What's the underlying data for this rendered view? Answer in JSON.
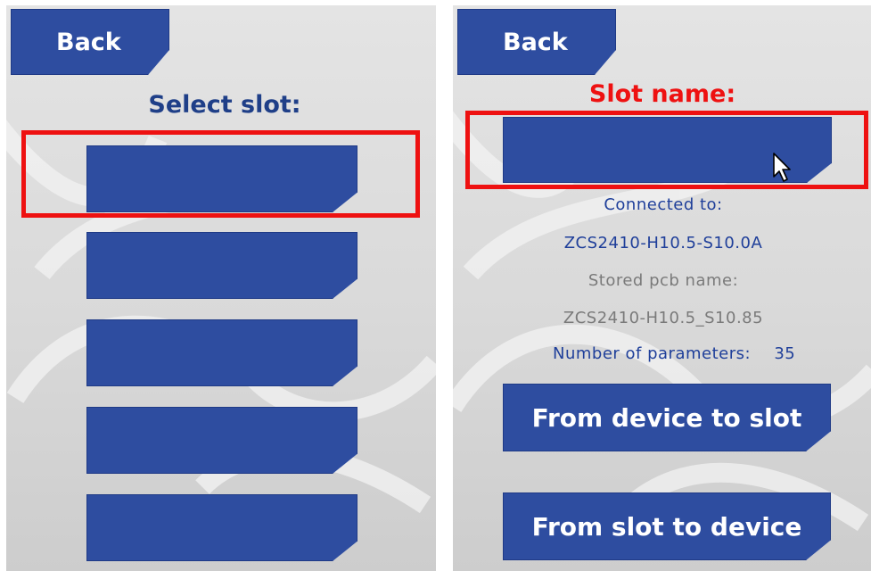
{
  "left_panel": {
    "back_label": "Back",
    "heading": "Select slot:",
    "slots": [
      {
        "label": ""
      },
      {
        "label": ""
      },
      {
        "label": ""
      },
      {
        "label": ""
      },
      {
        "label": ""
      }
    ],
    "highlight_color": "#ee1111"
  },
  "right_panel": {
    "back_label": "Back",
    "heading": "Slot name:",
    "slot_name_value": "",
    "connected_to_label": "Connected to:",
    "connected_to_value": "ZCS2410-H10.5-S10.0A",
    "stored_pcb_label": "Stored pcb name:",
    "stored_pcb_value": "ZCS2410-H10.5_S10.85",
    "parameters_label": "Number of parameters:",
    "parameters_value": "35",
    "device_to_slot_label": "From device to slot",
    "slot_to_device_label": "From slot to device",
    "cursor_icon": "arrow-cursor-icon"
  },
  "colors": {
    "button_blue": "#2e4da0",
    "heading_blue": "#1f3f88",
    "heading_red": "#ee1111",
    "text_blue": "#1f3f9a",
    "text_gray": "#7a7a7a"
  }
}
